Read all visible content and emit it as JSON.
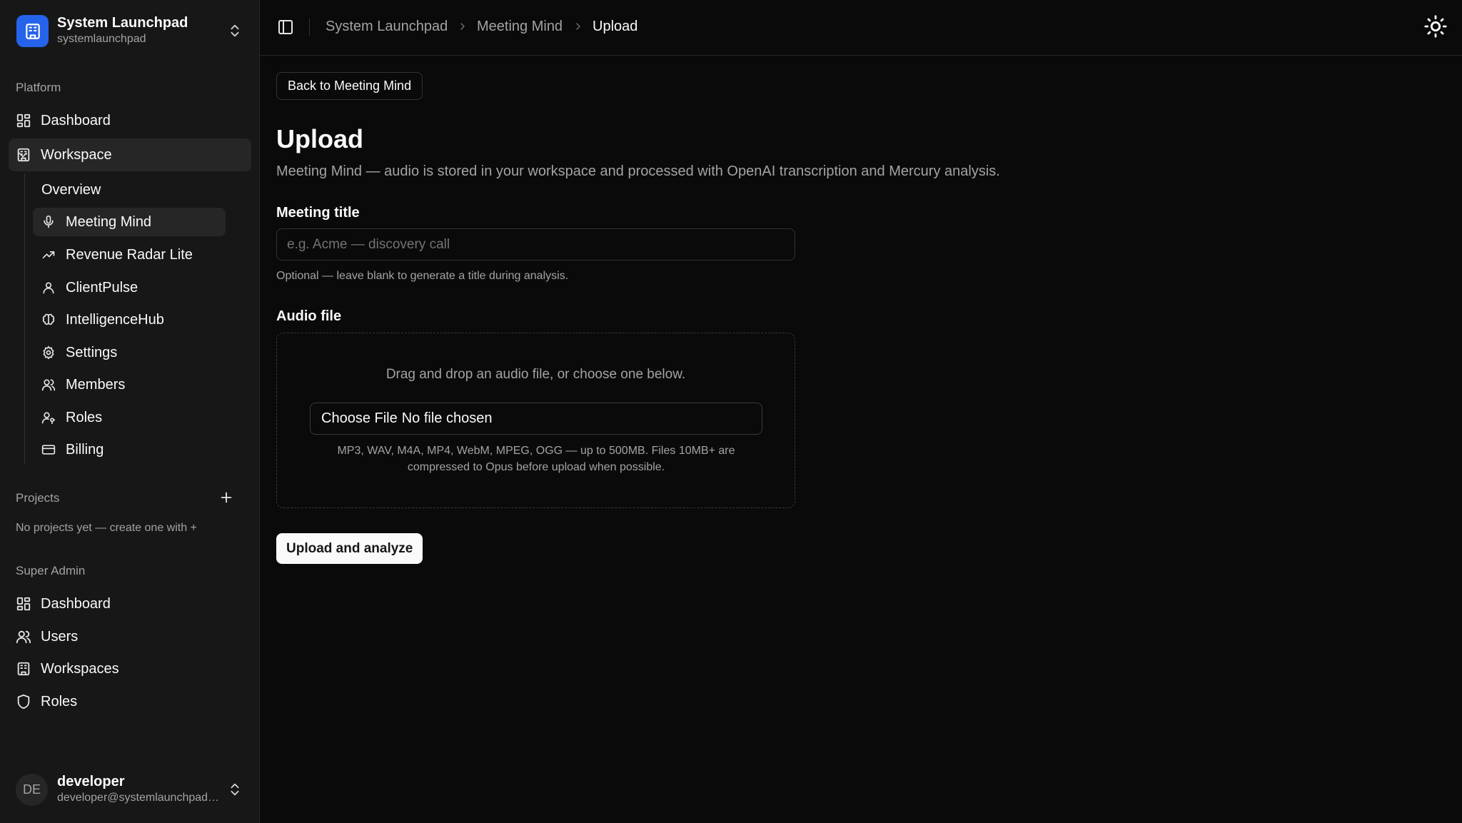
{
  "team": {
    "name": "System Launchpad",
    "slug": "systemlaunchpad"
  },
  "platform": {
    "label": "Platform",
    "dashboard": "Dashboard",
    "workspace": "Workspace",
    "workspace_items": [
      {
        "label": "Overview",
        "icon": "none"
      },
      {
        "label": "Meeting Mind",
        "icon": "mic-icon",
        "active": true
      },
      {
        "label": "Revenue Radar Lite",
        "icon": "trending-up-icon"
      },
      {
        "label": "ClientPulse",
        "icon": "user-icon"
      },
      {
        "label": "IntelligenceHub",
        "icon": "brain-icon"
      },
      {
        "label": "Settings",
        "icon": "gear-icon"
      },
      {
        "label": "Members",
        "icon": "users-icon"
      },
      {
        "label": "Roles",
        "icon": "user-key-icon"
      },
      {
        "label": "Billing",
        "icon": "credit-card-icon"
      }
    ]
  },
  "projects": {
    "label": "Projects",
    "empty": "No projects yet — create one with +"
  },
  "super_admin": {
    "label": "Super Admin",
    "items": [
      "Dashboard",
      "Users",
      "Workspaces",
      "Roles"
    ]
  },
  "user": {
    "initials": "DE",
    "name": "developer",
    "email": "developer@systemlaunchpad.com"
  },
  "breadcrumb": [
    "System Launchpad",
    "Meeting Mind",
    "Upload"
  ],
  "page": {
    "back_label": "Back to Meeting Mind",
    "title": "Upload",
    "description": "Meeting Mind — audio is stored in your workspace and processed with OpenAI transcription and Mercury analysis."
  },
  "form": {
    "title_label": "Meeting title",
    "title_placeholder": "e.g. Acme — discovery call",
    "title_value": "",
    "title_help": "Optional — leave blank to generate a title during analysis.",
    "audio_label": "Audio file",
    "dropzone_text": "Drag and drop an audio file, or choose one below.",
    "choose_file": "Choose File",
    "no_file": "No file chosen",
    "formats_note": "MP3, WAV, M4A, MP4, WebM, MPEG, OGG — up to 500MB. Files 10MB+ are compressed to Opus before upload when possible.",
    "submit": "Upload and analyze"
  },
  "colors": {
    "accent": "#2563eb",
    "background": "#0a0a0a",
    "sidebar": "#171717"
  }
}
